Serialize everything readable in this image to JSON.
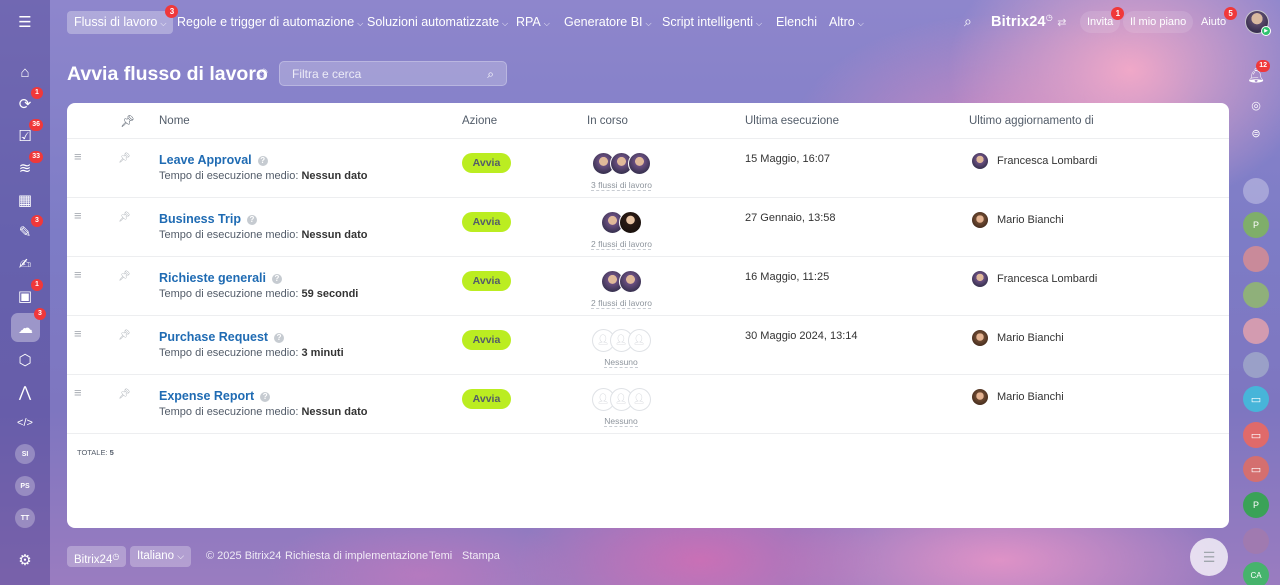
{
  "sidebar": {
    "menu_icon": "hamburger-icon",
    "items": [
      {
        "icon": "home-icon",
        "glyph": "⌂",
        "badge": ""
      },
      {
        "icon": "feed-icon",
        "glyph": "⟳",
        "badge": "1"
      },
      {
        "icon": "tasks-icon",
        "glyph": "☑",
        "badge": "36"
      },
      {
        "icon": "crm-icon",
        "glyph": "≋",
        "badge": "33"
      },
      {
        "icon": "calendar-icon",
        "glyph": "▦",
        "badge": ""
      },
      {
        "icon": "documents-icon",
        "glyph": "✎",
        "badge": "3"
      },
      {
        "icon": "sign-icon",
        "glyph": "✍",
        "badge": ""
      },
      {
        "icon": "chat-icon",
        "glyph": "▣",
        "badge": "1"
      },
      {
        "icon": "automation-icon",
        "glyph": "☁",
        "badge": "3"
      },
      {
        "icon": "market-icon",
        "glyph": "⬡",
        "badge": ""
      },
      {
        "icon": "company-icon",
        "glyph": "⋀",
        "badge": ""
      },
      {
        "icon": "developer-icon",
        "glyph": "</>",
        "badge": ""
      }
    ],
    "initials": [
      "SI",
      "PS",
      "TT"
    ],
    "settings_icon": "gear-icon"
  },
  "topnav": {
    "items": [
      {
        "label": "Flussi di lavoro",
        "chevron": true,
        "badge": "3"
      },
      {
        "label": "Regole e trigger di automazione",
        "chevron": true,
        "badge": ""
      },
      {
        "label": "Soluzioni automatizzate",
        "chevron": true,
        "badge": ""
      },
      {
        "label": "RPA",
        "chevron": true,
        "badge": ""
      },
      {
        "label": "Generatore BI",
        "chevron": true,
        "badge": ""
      },
      {
        "label": "Script intelligenti",
        "chevron": true,
        "badge": ""
      },
      {
        "label": "Elenchi",
        "chevron": false,
        "badge": ""
      },
      {
        "label": "Altro",
        "chevron": true,
        "badge": ""
      }
    ],
    "brand": "Bitrix24",
    "invite": {
      "label": "Invita",
      "badge": "1"
    },
    "plan": "Il mio piano",
    "help": {
      "label": "Aiuto",
      "badge": "5"
    }
  },
  "header": {
    "title": "Avvia flusso di lavoro",
    "search_placeholder": "Filtra e cerca"
  },
  "table": {
    "columns": {
      "name": "Nome",
      "action": "Azione",
      "running": "In corso",
      "last_run": "Ultima esecuzione",
      "updated_by": "Ultimo aggiornamento di"
    },
    "avg_label": "Tempo di esecuzione medio:",
    "action_label": "Avvia",
    "rows": [
      {
        "name": "Leave Approval",
        "avg": "Nessun dato",
        "flows": "3 flussi di lavoro",
        "last_run": "15 Maggio, 16:07",
        "updated_by": "Francesca Lombardi"
      },
      {
        "name": "Business Trip",
        "avg": "Nessun dato",
        "flows": "2 flussi di lavoro",
        "last_run": "27 Gennaio, 13:58",
        "updated_by": "Mario Bianchi"
      },
      {
        "name": "Richieste generali",
        "avg": "59 secondi",
        "flows": "2 flussi di lavoro",
        "last_run": "16 Maggio, 11:25",
        "updated_by": "Francesca Lombardi"
      },
      {
        "name": "Purchase Request",
        "avg": "3 minuti",
        "flows": "Nessuno",
        "last_run": "30 Maggio 2024, 13:14",
        "updated_by": "Mario Bianchi"
      },
      {
        "name": "Expense Report",
        "avg": "Nessun dato",
        "flows": "Nessuno",
        "last_run": "",
        "updated_by": "Mario Bianchi"
      }
    ],
    "total_label": "TOTALE:",
    "total_value": "5"
  },
  "rightbar": {
    "notifications_badge": "12"
  },
  "footer": {
    "brand": "Bitrix24",
    "language": "Italiano",
    "copyright": "© 2025 Bitrix24",
    "links": [
      "Richiesta di implementazione",
      "Temi",
      "Stampa"
    ]
  }
}
